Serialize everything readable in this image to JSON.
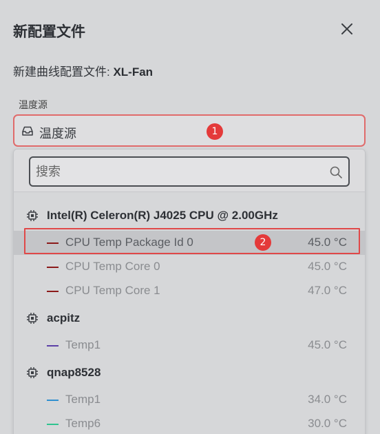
{
  "dialog": {
    "title": "新配置文件",
    "subtitle_prefix": "新建曲线配置文件: ",
    "subtitle_name": "XL-Fan"
  },
  "field": {
    "label": "温度源",
    "value": "温度源"
  },
  "search": {
    "placeholder": "搜索"
  },
  "badges": [
    "1",
    "2"
  ],
  "groups": [
    {
      "name": "Intel(R) Celeron(R) J4025 CPU @ 2.00GHz",
      "icon": "chip-icon",
      "items": [
        {
          "name": "CPU Temp Package Id 0",
          "value": "45.0 °C",
          "color": "#8b1a1a"
        },
        {
          "name": "CPU Temp Core 0",
          "value": "45.0 °C",
          "color": "#8b1a1a"
        },
        {
          "name": "CPU Temp Core 1",
          "value": "47.0 °C",
          "color": "#8b1a1a"
        }
      ]
    },
    {
      "name": "acpitz",
      "icon": "chip-icon",
      "items": [
        {
          "name": "Temp1",
          "value": "45.0 °C",
          "color": "#5b3fa6"
        }
      ]
    },
    {
      "name": "qnap8528",
      "icon": "chip-icon",
      "items": [
        {
          "name": "Temp1",
          "value": "34.0 °C",
          "color": "#2f8fd0"
        },
        {
          "name": "Temp6",
          "value": "30.0 °C",
          "color": "#2fc48f"
        }
      ]
    }
  ]
}
